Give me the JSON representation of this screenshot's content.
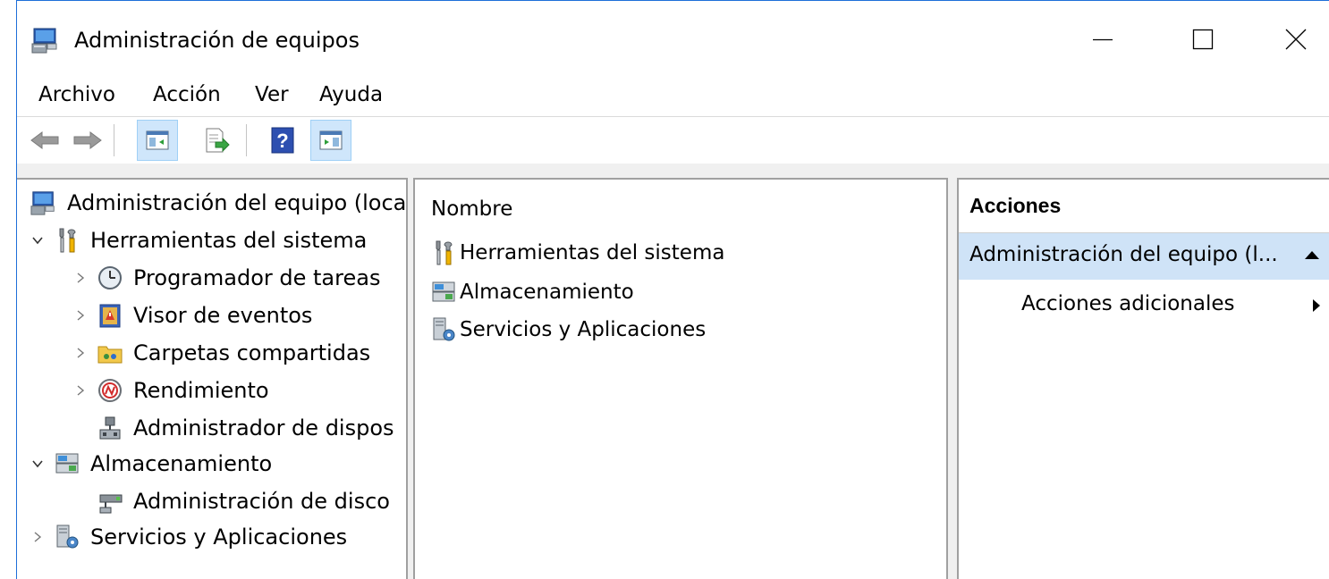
{
  "window": {
    "title": "Administración de equipos",
    "controls": [
      "minimize-icon",
      "maximize-icon",
      "close-icon"
    ]
  },
  "menubar": {
    "items": [
      "Archivo",
      "Acción",
      "Ver",
      "Ayuda"
    ]
  },
  "toolbar": {
    "buttons": [
      "back-arrow-icon",
      "forward-arrow-icon",
      "show-hide-console-tree-icon",
      "export-list-icon",
      "help-icon",
      "show-hide-action-pane-icon"
    ]
  },
  "tree": {
    "root": "Administración del equipo (loca",
    "items": [
      {
        "label": "Herramientas del sistema",
        "level": 1,
        "expanded": true
      },
      {
        "label": "Programador de tareas",
        "level": 2,
        "expanded": false
      },
      {
        "label": "Visor de eventos",
        "level": 2,
        "expanded": false
      },
      {
        "label": "Carpetas compartidas",
        "level": 2,
        "expanded": false
      },
      {
        "label": "Rendimiento",
        "level": 2,
        "expanded": false
      },
      {
        "label": "Administrador de dispos",
        "level": 2,
        "expanded": null
      },
      {
        "label": "Almacenamiento",
        "level": 1,
        "expanded": true
      },
      {
        "label": "Administración de disco",
        "level": 2,
        "expanded": null
      },
      {
        "label": "Servicios y Aplicaciones",
        "level": 1,
        "expanded": false
      }
    ]
  },
  "list": {
    "column_header": "Nombre",
    "rows": [
      "Herramientas del sistema",
      "Almacenamiento",
      "Servicios y Aplicaciones"
    ]
  },
  "actions": {
    "title": "Acciones",
    "section": "Administración del equipo (l...",
    "item": "Acciones adicionales"
  },
  "colors": {
    "window_border": "#1e6fd9",
    "selected_section": "#cfe3f7",
    "toolbar_active": "#cfe6fb"
  }
}
